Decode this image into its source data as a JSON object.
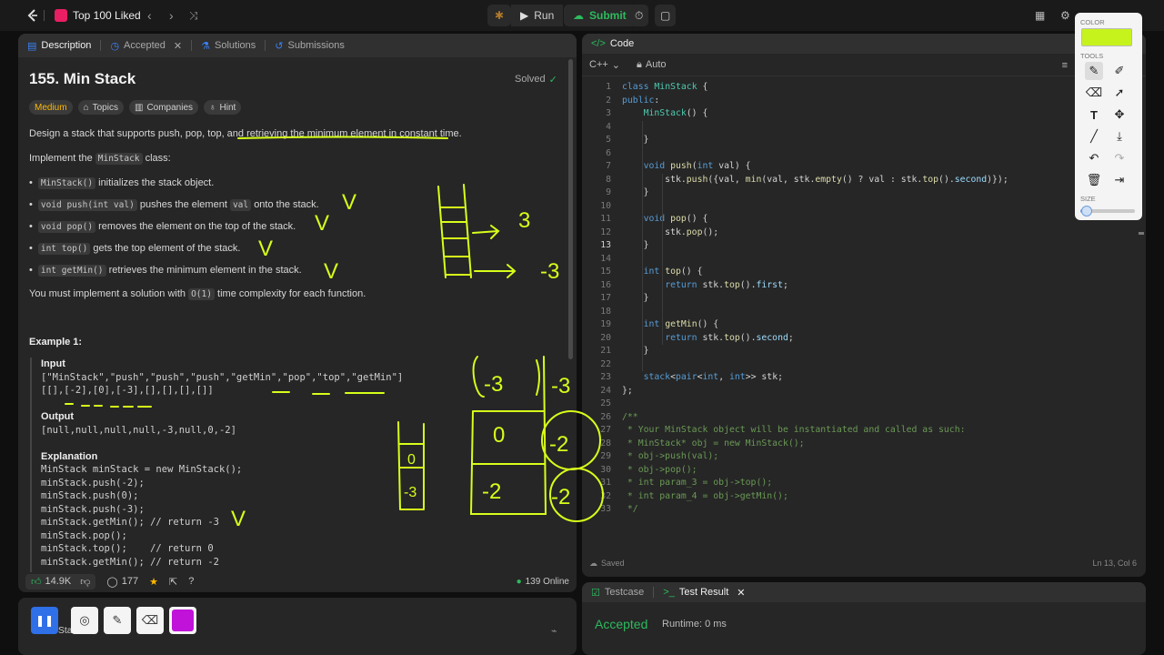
{
  "topbar": {
    "title": "Top 100 Liked",
    "run_label": "Run",
    "submit_label": "Submit"
  },
  "left_tabs": [
    {
      "label": "Description"
    },
    {
      "label": "Accepted"
    },
    {
      "label": "Solutions"
    },
    {
      "label": "Submissions"
    }
  ],
  "problem": {
    "title": "155. Min Stack",
    "status": "Solved",
    "difficulty": "Medium",
    "tags": [
      "Topics",
      "Companies",
      "Hint"
    ],
    "intro": "Design a stack that supports push, pop, top, and retrieving the minimum element in constant time.",
    "implement_prefix": "Implement the",
    "implement_code": "MinStack",
    "implement_suffix": "class:",
    "bullets": [
      {
        "code": "MinStack()",
        "text": "initializes the stack object."
      },
      {
        "code": "void push(int val)",
        "text": "pushes the element",
        "code2": "val",
        "text2": "onto the stack."
      },
      {
        "code": "void pop()",
        "text": "removes the element on the top of the stack."
      },
      {
        "code": "int top()",
        "text": "gets the top element of the stack."
      },
      {
        "code": "int getMin()",
        "text": "retrieves the minimum element in the stack."
      }
    ],
    "complexity_prefix": "You must implement a solution with",
    "complexity_code": "O(1)",
    "complexity_suffix": "time complexity for each function.",
    "example_title": "Example 1:",
    "example_lines": [
      "Input",
      "[\"MinStack\",\"push\",\"push\",\"push\",\"getMin\",\"pop\",\"top\",\"getMin\"]",
      "[[],[-2],[0],[-3],[],[],[],[]]",
      "",
      "Output",
      "[null,null,null,null,-3,null,0,-2]",
      "",
      "Explanation",
      "MinStack minStack = new MinStack();",
      "minStack.push(-2);",
      "minStack.push(0);",
      "minStack.push(-3);",
      "minStack.getMin(); // return -3",
      "minStack.pop();",
      "minStack.top();    // return 0",
      "minStack.getMin(); // return -2"
    ]
  },
  "footer": {
    "likes": "14.9K",
    "comments": "177",
    "online": "139 Online"
  },
  "bottom_left": {
    "title": "Min Stack"
  },
  "code_panel": {
    "title": "Code",
    "language": "C++",
    "mode": "Auto",
    "saved": "Saved",
    "cursor": "Ln 13, Col 6"
  },
  "code_lines": [
    "class MinStack {",
    "public:",
    "    MinStack() {",
    "",
    "    }",
    "",
    "    void push(int val) {",
    "        stk.push({val, min(val, stk.empty() ? val : stk.top().second)});",
    "    }",
    "",
    "    void pop() {",
    "        stk.pop();",
    "    }",
    "",
    "    int top() {",
    "        return stk.top().first;",
    "    }",
    "",
    "    int getMin() {",
    "        return stk.top().second;",
    "    }",
    "",
    "    stack<pair<int, int>> stk;",
    "};",
    "",
    "/**",
    " * Your MinStack object will be instantiated and called as such:",
    " * MinStack* obj = new MinStack();",
    " * obj->push(val);",
    " * obj->pop();",
    " * int param_3 = obj->top();",
    " * int param_4 = obj->getMin();",
    " */"
  ],
  "result_panel": {
    "tab_testcase": "Testcase",
    "tab_result": "Test Result",
    "status": "Accepted",
    "runtime": "Runtime: 0 ms"
  },
  "toolbox": {
    "color_label": "COLOR",
    "tools_label": "TOOLS",
    "size_label": "SIZE",
    "current_color": "#c6f31c",
    "size_level": 0.12
  },
  "annotation_texts": [
    "3",
    "-3",
    "-3",
    "-3",
    "0",
    "-2",
    "-2",
    "-2",
    "0",
    "-3",
    "V",
    "V",
    "V",
    "V",
    "V"
  ],
  "colors": {
    "accent_green": "#2cbb5d",
    "medium": "#ffb800",
    "annotation": "#d7ff1a"
  }
}
